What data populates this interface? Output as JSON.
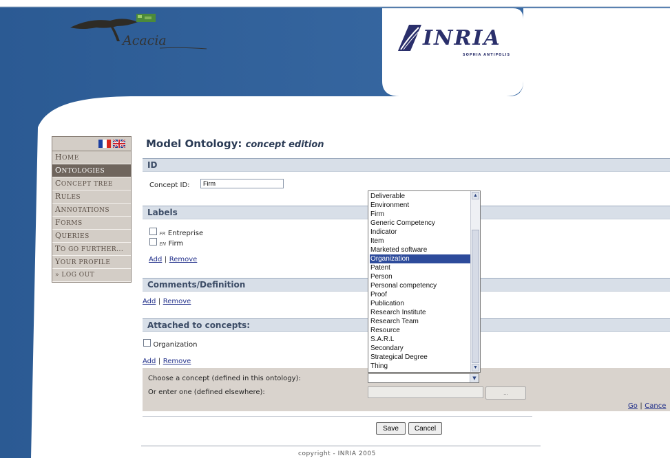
{
  "header": {
    "app_name": "Acacia",
    "org_name": "INRIA",
    "org_subtitle": "SOPHIA ANTIPOLIS"
  },
  "sidebar": {
    "flags": [
      "fr-flag-icon",
      "uk-flag-icon"
    ],
    "items": [
      {
        "label": "Home",
        "active": false
      },
      {
        "label": "Ontologies",
        "active": true
      },
      {
        "label": "Concept Tree",
        "active": false
      },
      {
        "label": "Rules",
        "active": false
      },
      {
        "label": "Annotations",
        "active": false
      },
      {
        "label": "Forms",
        "active": false
      },
      {
        "label": "Queries",
        "active": false
      },
      {
        "label": "To go further...",
        "active": false
      },
      {
        "label": "Your profile",
        "active": false
      },
      {
        "label": "» Log Out",
        "active": false
      }
    ]
  },
  "page": {
    "title": "Model Ontology:",
    "subtitle": "concept edition"
  },
  "id_section": {
    "heading": "ID",
    "concept_id_label": "Concept ID:",
    "concept_id_value": "Firm"
  },
  "labels_section": {
    "heading": "Labels",
    "labels": [
      {
        "lang": "FR",
        "text": "Entreprise"
      },
      {
        "lang": "EN",
        "text": "Firm"
      }
    ],
    "add": "Add",
    "sep": "|",
    "remove": "Remove"
  },
  "comments_section": {
    "heading": "Comments/Definition",
    "add": "Add",
    "sep": "|",
    "remove": "Remove"
  },
  "attached_section": {
    "heading": "Attached to concepts:",
    "concepts": [
      "Organization"
    ],
    "add": "Add",
    "sep": "|",
    "remove": "Remove"
  },
  "choose": {
    "choose_label": "Choose a concept (defined in this ontology):",
    "enter_label": "Or enter one (defined elsewhere):",
    "select_value": "",
    "enter_value": "",
    "browse_button": "...",
    "go": "Go",
    "sep": "|",
    "cancel": "Cance"
  },
  "concept_options": [
    "Deliverable",
    "Environment",
    "Firm",
    "Generic Competency",
    "Indicator",
    "Item",
    "Marketed software",
    "Organization",
    "Patent",
    "Person",
    "Personal competency",
    "Proof",
    "Publication",
    "Research Institute",
    "Research Team",
    "Resource",
    "S.A.R.L",
    "Secondary",
    "Strategical Degree",
    "Thing"
  ],
  "selected_option": "Organization",
  "form_buttons": {
    "save": "Save",
    "cancel": "Cancel"
  },
  "footer": {
    "copyright": "copyright - INRIA 2005"
  },
  "colors": {
    "header_blue": "#2f5f99",
    "sidebar_bg": "#d3cdc6",
    "active_nav": "#6f655d",
    "section_bar": "#d8dfe8",
    "selection": "#2d4b9b",
    "link": "#23318b"
  }
}
